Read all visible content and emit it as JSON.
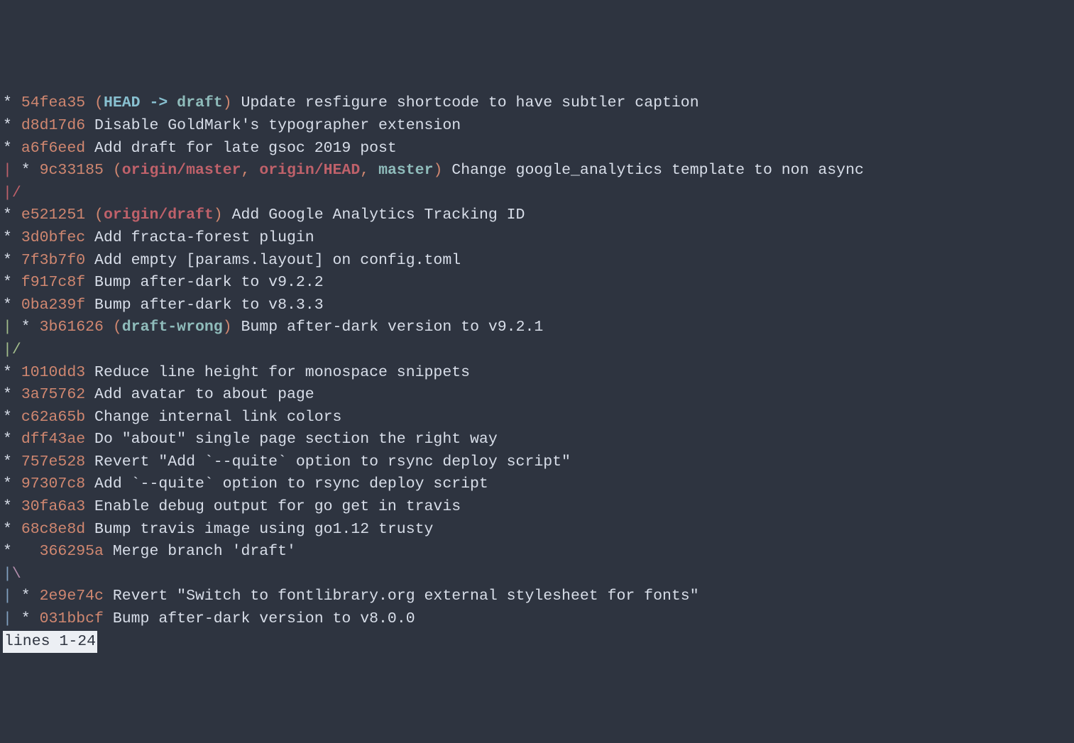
{
  "commits": [
    {
      "graph": "* ",
      "hash": "54fea35",
      "refs": [
        {
          "open": "(",
          "parts": [
            {
              "type": "head",
              "text": "HEAD -> "
            },
            {
              "type": "local",
              "text": "draft"
            }
          ],
          "close": ")"
        }
      ],
      "msg": "Update resfigure shortcode to have subtler caption"
    },
    {
      "graph": "* ",
      "hash": "d8d17d6",
      "refs": [],
      "msg": "Disable GoldMark's typographer extension"
    },
    {
      "graph": "* ",
      "hash": "a6f6eed",
      "refs": [],
      "msg": "Add draft for late gsoc 2019 post"
    },
    {
      "graph": [
        {
          "c": "pipe-red",
          "t": "|"
        },
        {
          "c": "graph",
          "t": " * "
        }
      ],
      "hash": "9c33185",
      "refs": [
        {
          "open": "(",
          "parts": [
            {
              "type": "remote",
              "text": "origin/master"
            },
            {
              "type": "plain",
              "text": ", "
            },
            {
              "type": "remote",
              "text": "origin/HEAD"
            },
            {
              "type": "plain",
              "text": ", "
            },
            {
              "type": "local",
              "text": "master"
            }
          ],
          "close": ")"
        }
      ],
      "msg": "Change google_analytics template to non async"
    },
    {
      "graph": [
        {
          "c": "pipe-red",
          "t": "|"
        },
        {
          "c": "pipe-red",
          "t": "/"
        }
      ],
      "hash": "",
      "refs": [],
      "msg": ""
    },
    {
      "graph": "* ",
      "hash": "e521251",
      "refs": [
        {
          "open": "(",
          "parts": [
            {
              "type": "remote",
              "text": "origin/draft"
            }
          ],
          "close": ")"
        }
      ],
      "msg": "Add Google Analytics Tracking ID"
    },
    {
      "graph": "* ",
      "hash": "3d0bfec",
      "refs": [],
      "msg": "Add fracta-forest plugin"
    },
    {
      "graph": "* ",
      "hash": "7f3b7f0",
      "refs": [],
      "msg": "Add empty [params.layout] on config.toml"
    },
    {
      "graph": "* ",
      "hash": "f917c8f",
      "refs": [],
      "msg": "Bump after-dark to v9.2.2"
    },
    {
      "graph": "* ",
      "hash": "0ba239f",
      "refs": [],
      "msg": "Bump after-dark to v8.3.3"
    },
    {
      "graph": [
        {
          "c": "pipe-green",
          "t": "|"
        },
        {
          "c": "graph",
          "t": " * "
        }
      ],
      "hash": "3b61626",
      "refs": [
        {
          "open": "(",
          "parts": [
            {
              "type": "local",
              "text": "draft-wrong"
            }
          ],
          "close": ")"
        }
      ],
      "msg": "Bump after-dark version to v9.2.1"
    },
    {
      "graph": [
        {
          "c": "pipe-green",
          "t": "|"
        },
        {
          "c": "pipe-green",
          "t": "/"
        }
      ],
      "hash": "",
      "refs": [],
      "msg": ""
    },
    {
      "graph": "* ",
      "hash": "1010dd3",
      "refs": [],
      "msg": "Reduce line height for monospace snippets"
    },
    {
      "graph": "* ",
      "hash": "3a75762",
      "refs": [],
      "msg": "Add avatar to about page"
    },
    {
      "graph": "* ",
      "hash": "c62a65b",
      "refs": [],
      "msg": "Change internal link colors"
    },
    {
      "graph": "* ",
      "hash": "dff43ae",
      "refs": [],
      "msg": "Do \"about\" single page section the right way"
    },
    {
      "graph": "* ",
      "hash": "757e528",
      "refs": [],
      "msg": "Revert \"Add `--quite` option to rsync deploy script\""
    },
    {
      "graph": "* ",
      "hash": "97307c8",
      "refs": [],
      "msg": "Add `--quite` option to rsync deploy script"
    },
    {
      "graph": "* ",
      "hash": "30fa6a3",
      "refs": [],
      "msg": "Enable debug output for go get in travis"
    },
    {
      "graph": "* ",
      "hash": "68c8e8d",
      "refs": [],
      "msg": "Bump travis image using go1.12 trusty"
    },
    {
      "graph": "*   ",
      "hash": "366295a",
      "refs": [],
      "msg": "Merge branch 'draft'"
    },
    {
      "graph": [
        {
          "c": "pipe-blue",
          "t": "|"
        },
        {
          "c": "backslash-purple",
          "t": "\\"
        }
      ],
      "hash": "",
      "refs": [],
      "msg": ""
    },
    {
      "graph": [
        {
          "c": "pipe-blue",
          "t": "|"
        },
        {
          "c": "graph",
          "t": " * "
        }
      ],
      "hash": "2e9e74c",
      "refs": [],
      "msg": "Revert \"Switch to fontlibrary.org external stylesheet for fonts\""
    },
    {
      "graph": [
        {
          "c": "pipe-blue",
          "t": "|"
        },
        {
          "c": "graph",
          "t": " * "
        }
      ],
      "hash": "031bbcf",
      "refs": [],
      "msg": "Bump after-dark version to v8.0.0"
    }
  ],
  "status": "lines 1-24"
}
